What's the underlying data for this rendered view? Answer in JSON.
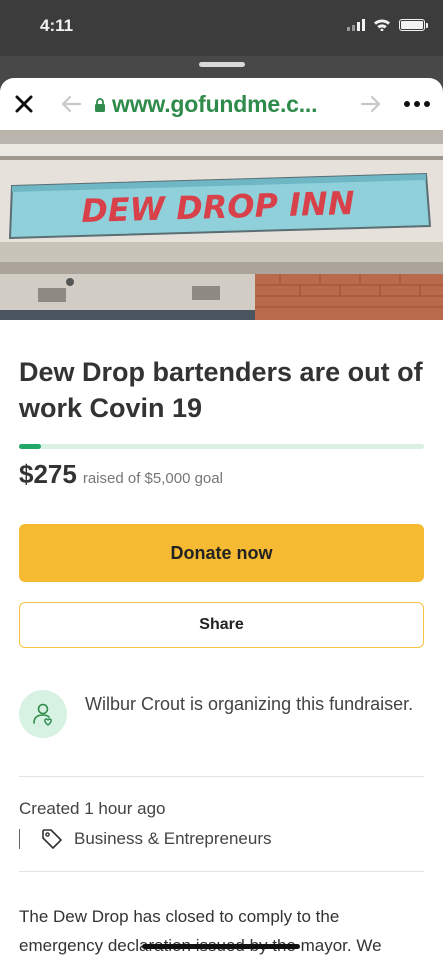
{
  "status_bar": {
    "time": "4:11"
  },
  "browser": {
    "url": "www.gofundme.c..."
  },
  "hero": {
    "sign_text": "DEW DROP INN"
  },
  "campaign": {
    "title": "Dew Drop bartenders are out of work Covin 19",
    "raised": "$275",
    "goal_text": "raised of $5,000 goal",
    "progress_fraction": 0.055,
    "donate_label": "Donate now",
    "share_label": "Share",
    "organizer_text": "Wilbur Crout is organizing this fundraiser.",
    "created_text": "Created 1 hour ago",
    "category": "Business & Entrepreneurs",
    "story": "The Dew Drop has closed to comply to the emergency declaration issued by the mayor. We"
  },
  "colors": {
    "brand_green": "#2e8b4a",
    "progress_green": "#21a866",
    "donate_yellow": "#f5b932"
  },
  "icons": [
    "close-icon",
    "back-arrow-icon",
    "lock-icon",
    "forward-arrow-icon",
    "more-icon",
    "organizer-avatar-icon",
    "tag-icon"
  ]
}
